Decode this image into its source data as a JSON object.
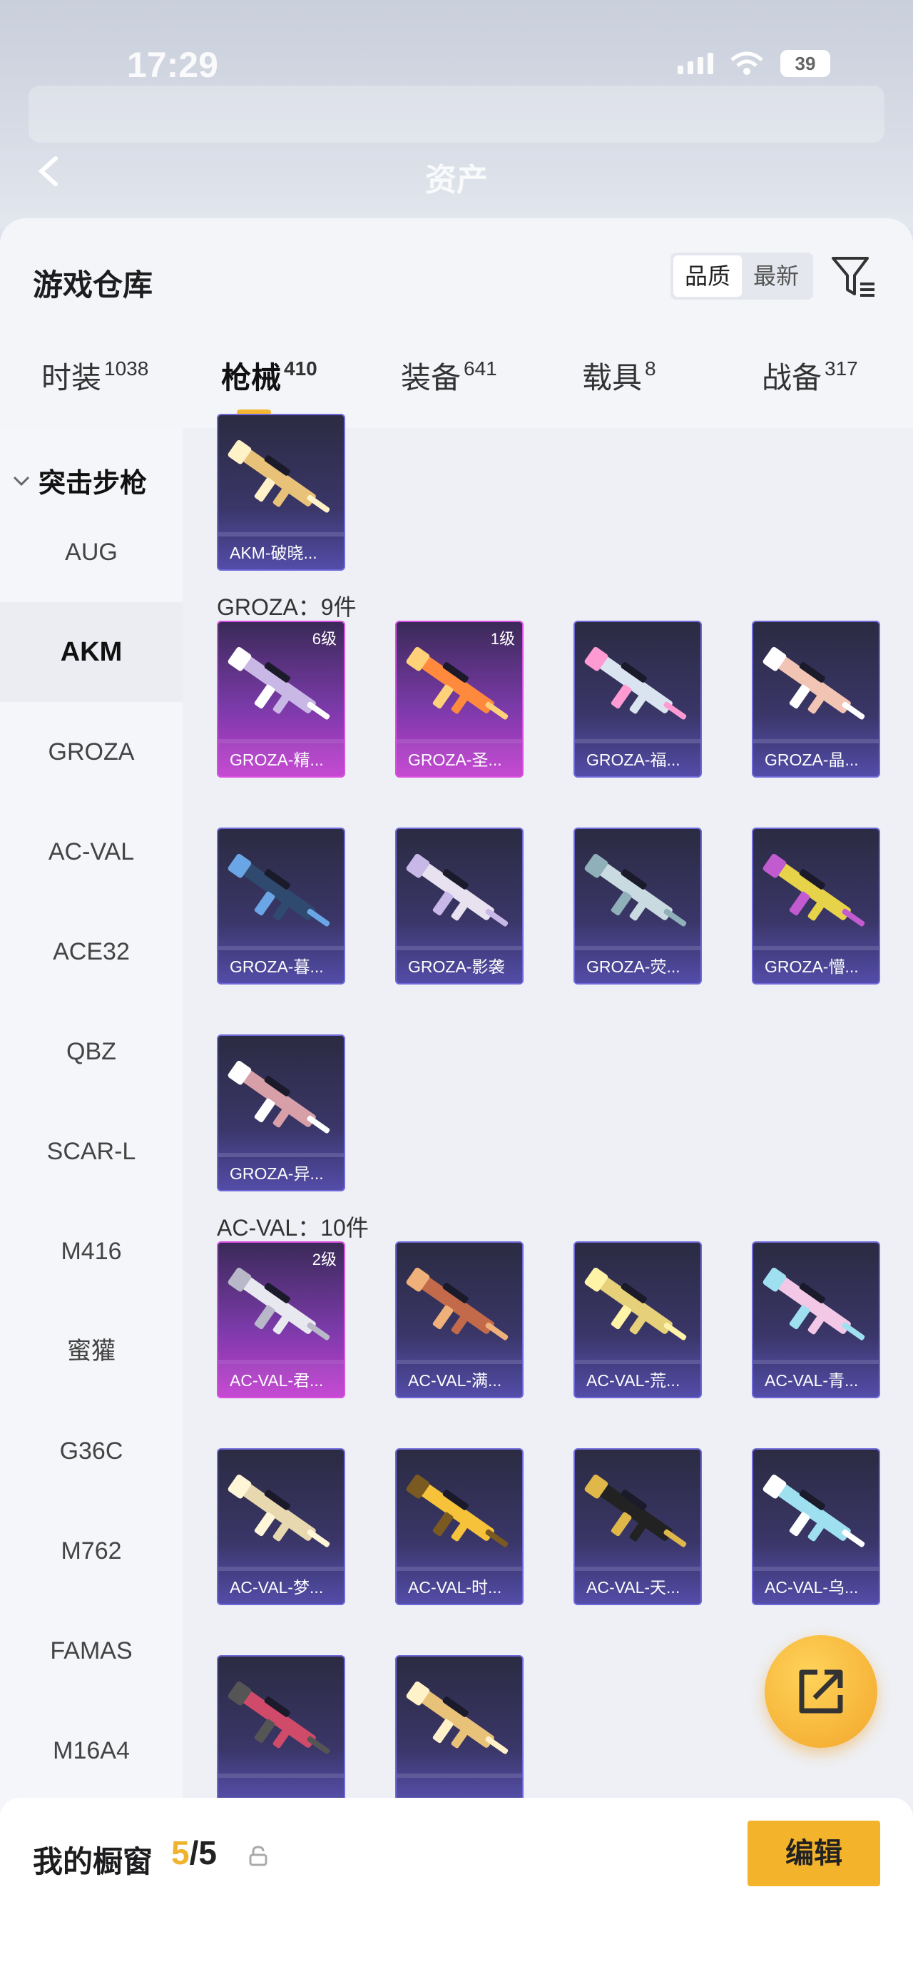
{
  "status_bar": {
    "time": "17:29",
    "battery": "39"
  },
  "header": {
    "title": "资产"
  },
  "panel": {
    "title": "游戏仓库",
    "sort_options": [
      "品质",
      "最新"
    ],
    "tabs": [
      {
        "label": "时装",
        "count": "1038"
      },
      {
        "label": "枪械",
        "count": "410"
      },
      {
        "label": "装备",
        "count": "641"
      },
      {
        "label": "载具",
        "count": "8"
      },
      {
        "label": "战备",
        "count": "317"
      }
    ]
  },
  "sidebar": {
    "group": "突击步枪",
    "items": [
      "AUG",
      "AKM",
      "GROZA",
      "AC-VAL",
      "ACE32",
      "QBZ",
      "SCAR-L",
      "M416",
      "蜜獾",
      "G36C",
      "M762",
      "FAMAS",
      "M16A4"
    ],
    "active": "AKM"
  },
  "sections": [
    {
      "label": "",
      "cards": [
        {
          "name": "AKM-破晓...",
          "level": "",
          "rarity": "blue"
        }
      ]
    },
    {
      "label": "GROZA：9件",
      "cards": [
        {
          "name": "GROZA-精...",
          "level": "6级",
          "rarity": "purple"
        },
        {
          "name": "GROZA-圣...",
          "level": "1级",
          "rarity": "purple"
        },
        {
          "name": "GROZA-福...",
          "level": "",
          "rarity": "blue"
        },
        {
          "name": "GROZA-晶...",
          "level": "",
          "rarity": "blue"
        },
        {
          "name": "GROZA-暮...",
          "level": "",
          "rarity": "blue"
        },
        {
          "name": "GROZA-影袭",
          "level": "",
          "rarity": "blue"
        },
        {
          "name": "GROZA-荧...",
          "level": "",
          "rarity": "blue"
        },
        {
          "name": "GROZA-懵...",
          "level": "",
          "rarity": "blue"
        },
        {
          "name": "GROZA-异...",
          "level": "",
          "rarity": "blue"
        }
      ]
    },
    {
      "label": "AC-VAL：10件",
      "cards": [
        {
          "name": "AC-VAL-君...",
          "level": "2级",
          "rarity": "purple"
        },
        {
          "name": "AC-VAL-满...",
          "level": "",
          "rarity": "blue"
        },
        {
          "name": "AC-VAL-荒...",
          "level": "",
          "rarity": "blue"
        },
        {
          "name": "AC-VAL-青...",
          "level": "",
          "rarity": "blue"
        },
        {
          "name": "AC-VAL-梦...",
          "level": "",
          "rarity": "blue"
        },
        {
          "name": "AC-VAL-时...",
          "level": "",
          "rarity": "blue"
        },
        {
          "name": "AC-VAL-天...",
          "level": "",
          "rarity": "blue"
        },
        {
          "name": "AC-VAL-乌...",
          "level": "",
          "rarity": "blue"
        },
        {
          "name": "",
          "level": "",
          "rarity": "blue"
        },
        {
          "name": "",
          "level": "",
          "rarity": "blue"
        }
      ]
    }
  ],
  "bottom_bar": {
    "label": "我的橱窗",
    "count_used": "5",
    "count_total": "/5",
    "edit_label": "编辑"
  },
  "colors": {
    "accent": "#f3b32b",
    "blue_card": "#5b54b8",
    "purple_card": "#c23ed0"
  },
  "icons": [
    "back-icon",
    "filter-icon",
    "share-icon",
    "lock-icon",
    "chevron-down-icon",
    "wifi-icon",
    "signal-icon",
    "battery-icon"
  ]
}
